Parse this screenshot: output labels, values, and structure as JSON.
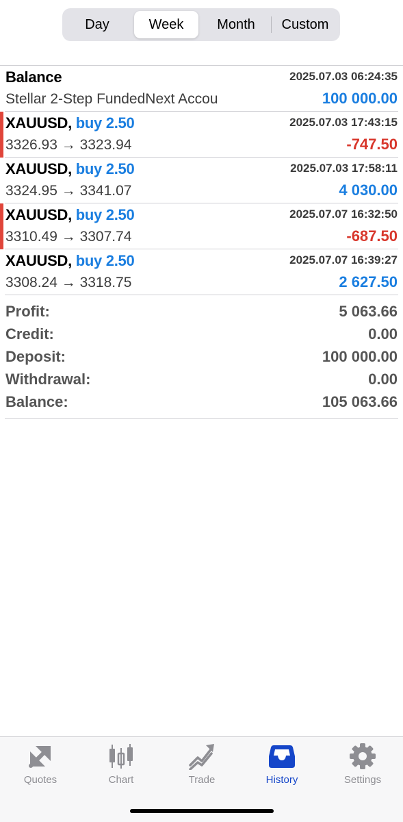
{
  "period_tabs": [
    {
      "label": "Day",
      "selected": false
    },
    {
      "label": "Week",
      "selected": true
    },
    {
      "label": "Month",
      "selected": false
    },
    {
      "label": "Custom",
      "selected": false
    }
  ],
  "balance_entry": {
    "title": "Balance",
    "time": "2025.07.03 06:24:35",
    "comment": "Stellar 2-Step FundedNext Accou",
    "amount": "100 000.00"
  },
  "deals": [
    {
      "symbol": "XAUUSD,",
      "side": "buy 2.50",
      "time": "2025.07.03 17:43:15",
      "prices": "3326.93 → 3323.94",
      "profit": "-747.50",
      "loss": true
    },
    {
      "symbol": "XAUUSD,",
      "side": "buy 2.50",
      "time": "2025.07.03 17:58:11",
      "prices": "3324.95 → 3341.07",
      "profit": "4 030.00",
      "loss": false
    },
    {
      "symbol": "XAUUSD,",
      "side": "buy 2.50",
      "time": "2025.07.07 16:32:50",
      "prices": "3310.49 → 3307.74",
      "profit": "-687.50",
      "loss": true
    },
    {
      "symbol": "XAUUSD,",
      "side": "buy 2.50",
      "time": "2025.07.07 16:39:27",
      "prices": "3308.24 → 3318.75",
      "profit": "2 627.50",
      "loss": false
    }
  ],
  "summary": [
    {
      "label": "Profit:",
      "value": "5 063.66"
    },
    {
      "label": "Credit:",
      "value": "0.00"
    },
    {
      "label": "Deposit:",
      "value": "100 000.00"
    },
    {
      "label": "Withdrawal:",
      "value": "0.00"
    },
    {
      "label": "Balance:",
      "value": "105 063.66"
    }
  ],
  "tabbar": [
    {
      "label": "Quotes",
      "icon": "quotes-arrows-icon",
      "active": false
    },
    {
      "label": "Chart",
      "icon": "candlestick-chart-icon",
      "active": false
    },
    {
      "label": "Trade",
      "icon": "trade-trend-icon",
      "active": false
    },
    {
      "label": "History",
      "icon": "history-inbox-icon",
      "active": true
    },
    {
      "label": "Settings",
      "icon": "gear-icon",
      "active": false
    }
  ],
  "colors": {
    "accent_blue": "#1a7ee0",
    "loss_red": "#d8372c",
    "active_tab": "#1546c9",
    "inactive_tab": "#8e8e93"
  }
}
